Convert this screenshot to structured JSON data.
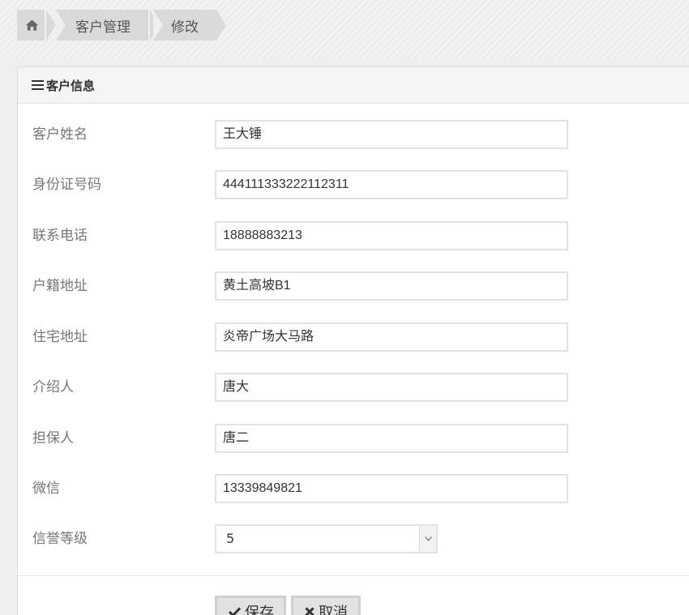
{
  "breadcrumb": {
    "home_icon": "home-icon",
    "items": [
      "客户管理",
      "修改"
    ]
  },
  "panel": {
    "title": "客户信息",
    "title_icon": "menu-icon"
  },
  "form": {
    "name_label": "客户姓名",
    "name_value": "王大锤",
    "id_label": "身份证号码",
    "id_value": "444111333222112311",
    "phone_label": "联系电话",
    "phone_value": "18888883213",
    "domicile_label": "户籍地址",
    "domicile_value": "黄土高坡B1",
    "residence_label": "住宅地址",
    "residence_value": "炎帝广场大马路",
    "referrer_label": "介绍人",
    "referrer_value": "唐大",
    "guarantor_label": "担保人",
    "guarantor_value": "唐二",
    "wechat_label": "微信",
    "wechat_value": "13339849821",
    "credit_label": "信誉等级",
    "credit_value": "5"
  },
  "actions": {
    "save_label": "保存",
    "cancel_label": "取消"
  }
}
